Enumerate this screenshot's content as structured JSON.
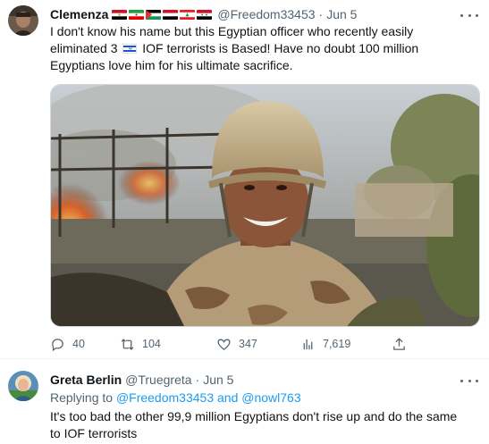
{
  "tweet1": {
    "author": {
      "name": "Clemenza",
      "flags": [
        "egypt-flag",
        "iran-flag",
        "palestine-flag",
        "yemen-flag",
        "lebanon-flag",
        "syria-flag"
      ],
      "handle": "@Freedom33453",
      "date": "Jun 5"
    },
    "text": {
      "line1": "I don't know his name but this Egyptian officer who recently easily",
      "line2_pre": "eliminated 3",
      "line2_post": "IOF terrorists is Based! Have no doubt 100 million",
      "line3": "Egyptians love him for his ultimate sacrifice.",
      "inline_flag": "israel-flag"
    },
    "media": {
      "description_icon": "photo-soldier-selfie"
    },
    "actions": {
      "replies": "40",
      "retweets": "104",
      "likes": "347",
      "views": "7,619"
    }
  },
  "tweet2": {
    "author": {
      "name": "Greta Berlin",
      "handle": "@Truegreta",
      "date": "Jun 5"
    },
    "reply_to": {
      "prefix": "Replying to",
      "user1": "@Freedom33453",
      "conj": "and",
      "user2": "@nowl763"
    },
    "text": {
      "line1": "It's too bad the other 99,9 million Egyptians don't rise up and do the same",
      "line2": "to IOF terrorists"
    }
  },
  "colors": {
    "text": "#0f1419",
    "secondary": "#536471",
    "link": "#1d9bf0",
    "border": "#eff3f4"
  }
}
